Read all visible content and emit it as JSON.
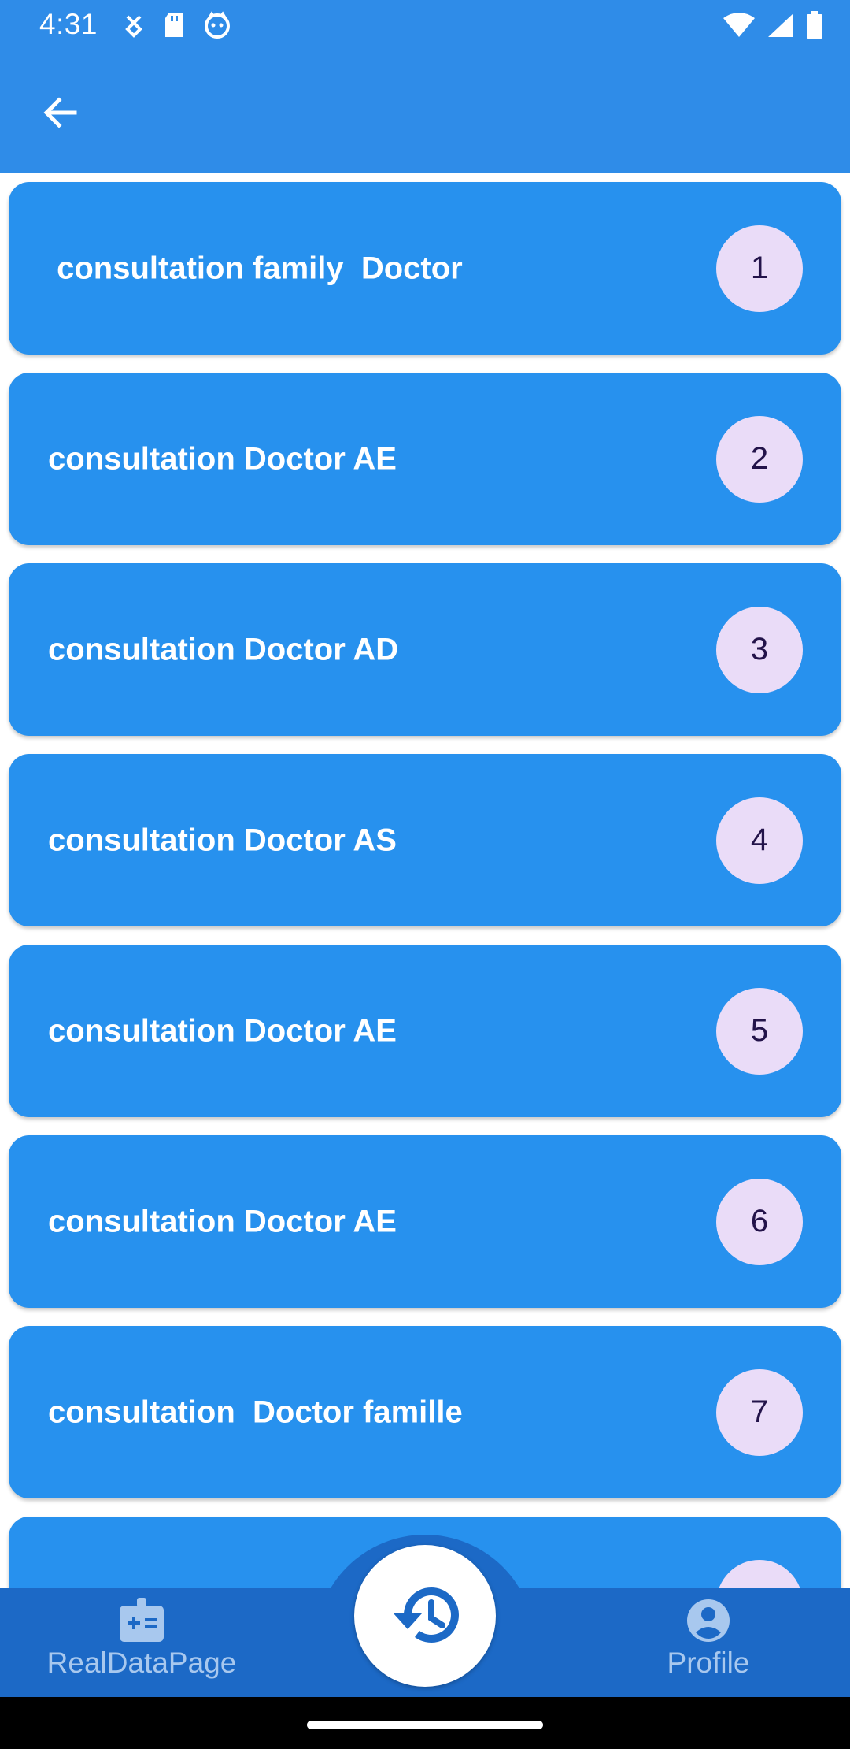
{
  "status_bar": {
    "time": "4:31"
  },
  "list": [
    {
      "label": " consultation family  Doctor",
      "number": "1"
    },
    {
      "label": "consultation Doctor AE",
      "number": "2"
    },
    {
      "label": "consultation Doctor AD",
      "number": "3"
    },
    {
      "label": "consultation Doctor AS",
      "number": "4"
    },
    {
      "label": "consultation Doctor AE",
      "number": "5"
    },
    {
      "label": "consultation Doctor AE",
      "number": "6"
    },
    {
      "label": "consultation  Doctor famille",
      "number": "7"
    }
  ],
  "bottom_nav": {
    "left_label": "RealDataPage",
    "right_label": "Profile"
  },
  "colors": {
    "app_bar": "#2f8ce8",
    "card": "#2791ee",
    "badge": "#eadcf8",
    "bottom_nav": "#1c69c6"
  }
}
